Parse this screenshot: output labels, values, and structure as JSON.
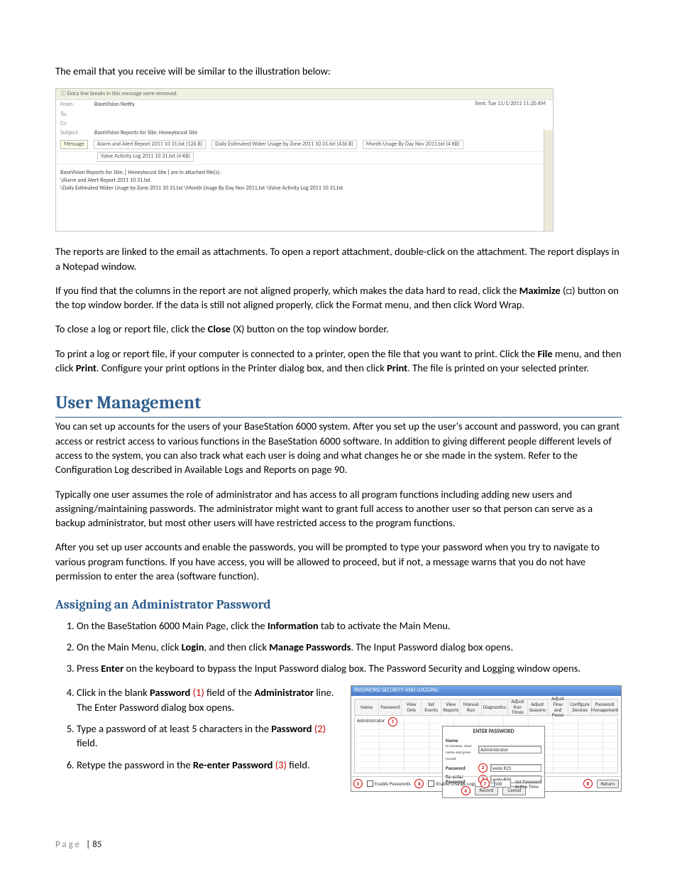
{
  "intro": "The email that you receive will be similar to the illustration below:",
  "email": {
    "banner": "Extra line breaks in this message were removed.",
    "from_label": "From:",
    "from_value": "BaseVision Notify",
    "to_label": "To:",
    "to_value": "",
    "cc_label": "Cc:",
    "subject_label": "Subject:",
    "subject_value": "BaseVision Reports for Site: Honeylocust Site",
    "sent_label": "Sent:",
    "sent_value": "Tue 11/1/2011 11:20 AM",
    "message_btn": "Message",
    "attach1": "Alarm and Alert Report 2011 10 31.txt (126 B)",
    "attach2": "Daily Estimated Water Usage by Zone 2011 10 31.txt (436 B)",
    "attach3": "Month Usage By Day Nov 2011.txt (4 KB)",
    "attach4": "Valve Activity Log 2011 10 31.txt (4 KB)",
    "body_line1": "BaseVision Reports for Site: [ Honeylocust Site ] are in attached file(s):",
    "body_line2": "\\Alarm and Alert Report 2011 10 31.txt",
    "body_line3": "\\Daily Estimated Water Usage by Zone 2011 10 31.txt \\Month Usage By Day Nov 2011.txt \\Valve Activity Log 2011 10 31.txt"
  },
  "p1a": "The reports are linked to the email as attachments. To open a report attachment, double-click on the attachment. The report displays in a Notepad window.",
  "p2a": "If you find that the columns in the report are not aligned properly, which makes the data hard to read, click the ",
  "p2b": "Maximize",
  "p2c": " (□) button on the top window border. If the data is still not aligned properly, click the Format menu, and then click Word Wrap.",
  "p3a": "To close a log or report file, click the ",
  "p3b": "Close",
  "p3c": " (X) button on the top window border.",
  "p4a": "To print a log or report file, if your computer is connected to a printer, open the file that you want to print. Click the ",
  "p4b": "File",
  "p4c": " menu, and then click ",
  "p4d": "Print",
  "p4e": ". Configure your print options in the Printer dialog box, and then click ",
  "p4f": "Print",
  "p4g": ". The file is printed on your selected printer.",
  "h1": "User Management",
  "um1": "You can set up accounts for the users of your BaseStation 6000 system. After you set up the user's account and password, you can grant access or restrict access to various functions in the BaseStation 6000 software. In addition to giving different people different levels of access to the system, you can also track what each user is doing and what changes he or she made in the system. Refer to the Configuration Log described in Available Logs and Reports on page 90.",
  "um2": "Typically one user assumes the role of administrator and has access to all program functions including adding new users and assigning/maintaining passwords. The administrator might want to grant full access to another user so that person can serve as a backup administrator, but most other users will have restricted access to the program functions.",
  "um3": "After you set up user accounts and enable the passwords, you will be prompted to type your password when you try to navigate to various program functions. If you have access, you will be allowed to proceed, but if not, a message warns that you do not have permission to enter the area (software function).",
  "h2": "Assigning an Administrator Password",
  "steps": {
    "s1a": "On the BaseStation 6000 Main Page, click the ",
    "s1b": "Information",
    "s1c": " tab to activate the Main Menu.",
    "s2a": "On the Main Menu, click ",
    "s2b": "Login",
    "s2c": ", and then click ",
    "s2d": "Manage Passwords",
    "s2e": ". The Input Password dialog box opens.",
    "s3a": "Press ",
    "s3b": "Enter",
    "s3c": " on the keyboard to bypass the Input Password dialog box. The Password Security and Logging window opens.",
    "s4a": "Click in the blank ",
    "s4b": "Password",
    "s4c": " (1)",
    "s4d": " field of the ",
    "s4e": "Administrator",
    "s4f": " line. The Enter Password dialog box opens.",
    "s5a": "Type a password of at least 5 characters in the ",
    "s5b": "Password",
    "s5c": " (2)",
    "s5d": " field.",
    "s6a": "Retype the password in the ",
    "s6b": "Re-enter Password",
    "s6c": " (3)",
    "s6d": " field."
  },
  "pwd": {
    "title": "PASSWORD SECURITY AND LOGGING",
    "cols": [
      "Name",
      "Password",
      "View Only",
      "Set Events",
      "View Reports",
      "Manual Run",
      "Diagnostics",
      "Adjust Run Times",
      "Adjust Seasons",
      "Adjust Flow and Pause",
      "Configure Devices",
      "Password Management"
    ],
    "admin_row": "Administrator",
    "dialog_title": "ENTER PASSWORD",
    "name_label": "Name",
    "name_hint": "to rename, clear name and press record",
    "name_value": "Administrator",
    "password_label": "Password",
    "password_value": "wate R23",
    "reenter_label": "Re-enter Password",
    "reenter_value": "wate R23",
    "record_btn": "Record",
    "cancel_btn": "Cancel",
    "enable_pwd": "Enable Passwords",
    "enable_log": "Enable Change Logs",
    "active_label": "Set Password Active Time",
    "return_btn": "Return",
    "m1": "1",
    "m2": "2",
    "m3": "3",
    "m4": "4",
    "m5": "5",
    "m6": "6",
    "m7": "7",
    "m8": "8",
    "field_value": "500"
  },
  "footer_label": "Page ",
  "footer_sep": "| ",
  "footer_num": "85"
}
